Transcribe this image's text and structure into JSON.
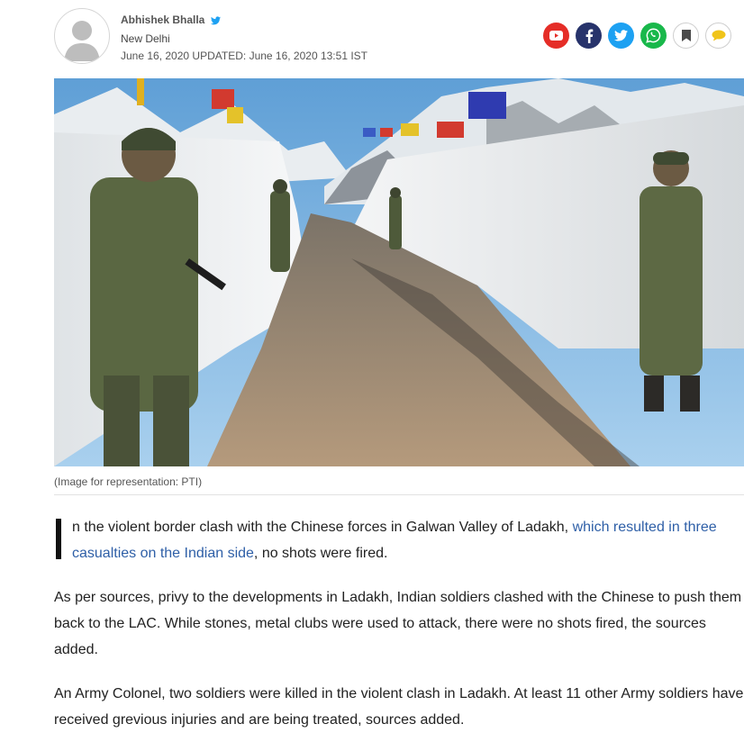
{
  "author": {
    "name": "Abhishek Bhalla",
    "location": "New Delhi",
    "published": "June 16, 2020",
    "updated_label": "UPDATED:",
    "updated": "June 16, 2020 13:51 IST"
  },
  "share": [
    {
      "icon": "youtube-icon",
      "color": "#e52d27"
    },
    {
      "icon": "facebook-icon",
      "color": "#27336b"
    },
    {
      "icon": "twitter-icon",
      "color": "#1da1f2"
    },
    {
      "icon": "whatsapp-icon",
      "color": "#19b84b"
    },
    {
      "icon": "bookmark-icon",
      "color": "#ffffff"
    },
    {
      "icon": "comment-icon",
      "color": "#ffffff"
    }
  ],
  "image": {
    "caption": "(Image for representation: PTI)"
  },
  "article": {
    "p1_dropcap": "I",
    "p1_before": "n the violent border clash with the Chinese forces in Galwan Valley of Ladakh, ",
    "p1_link": "which resulted in three casualties on the Indian side",
    "p1_after": ", no shots were fired.",
    "p2": "As per sources, privy to the developments in Ladakh, Indian soldiers clashed with the Chinese to push them back to the LAC. While stones, metal clubs were used to attack, there were no shots fired, the sources added.",
    "p3": "An Army Colonel, two soldiers were killed in the violent clash in Ladakh. At least 11 other Army soldiers have received grevious injuries and are being treated, sources added."
  }
}
